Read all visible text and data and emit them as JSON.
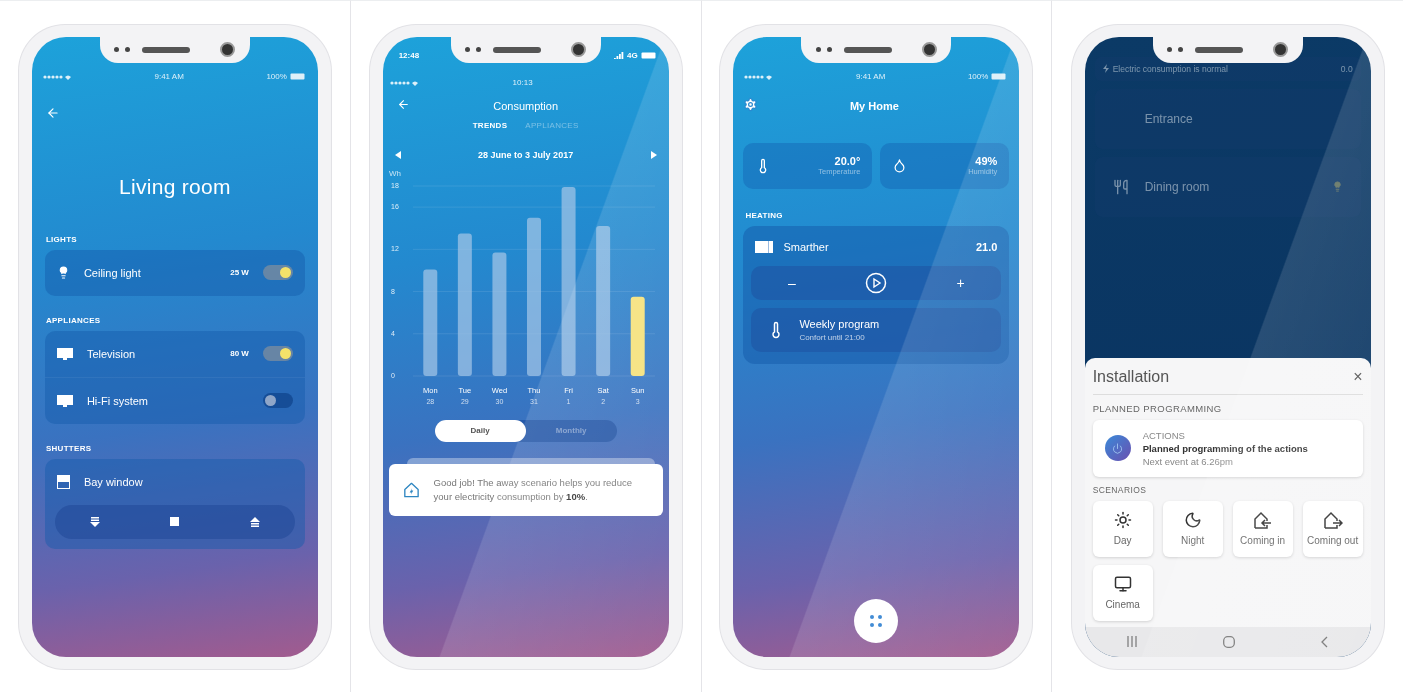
{
  "living_room": {
    "status": {
      "time": "9:41 AM",
      "battery": "100%"
    },
    "title": "Living room",
    "sections": [
      {
        "heading": "LIGHTS",
        "items": [
          {
            "kind": "light",
            "name": "Ceiling light",
            "power": "25 W",
            "on": true
          }
        ]
      },
      {
        "heading": "APPLIANCES",
        "items": [
          {
            "kind": "appliance",
            "name": "Television",
            "power": "80 W",
            "on": true
          },
          {
            "kind": "appliance",
            "name": "Hi-Fi system",
            "on": false
          }
        ]
      },
      {
        "heading": "SHUTTERS",
        "items": [
          {
            "kind": "shutter",
            "name": "Bay window"
          }
        ]
      }
    ]
  },
  "consumption": {
    "status": {
      "time": "12:48",
      "network": "4G"
    },
    "inner_status": {
      "time": "10:13"
    },
    "title": "Consumption",
    "tabs": [
      {
        "label": "TRENDS",
        "selected": true
      },
      {
        "label": "APPLIANCES",
        "selected": false
      }
    ],
    "period": "28 June to 3 July 2017",
    "chart_data": {
      "type": "bar",
      "ylabel": "Wh",
      "categories": [
        "Mon",
        "Tue",
        "Wed",
        "Thu",
        "Fri",
        "Sat",
        "Sun"
      ],
      "stacked": true,
      "grid": true,
      "ylim": [
        0,
        18
      ],
      "yticks": [
        0,
        4,
        8,
        12,
        16,
        18
      ],
      "series": [
        {
          "color": "#9fc3e6",
          "values": [
            10.1,
            13.5,
            11.7,
            15.0,
            17.9,
            14.2,
            null
          ]
        },
        {
          "color": "#f5e17a",
          "values": [
            null,
            null,
            null,
            null,
            null,
            null,
            7.5
          ]
        }
      ]
    },
    "dates": [
      "28",
      "29",
      "30",
      "31",
      "1",
      "2",
      "3"
    ],
    "periods": [
      {
        "label": "Daily",
        "selected": true
      },
      {
        "label": "Monthly",
        "selected": false
      }
    ],
    "tip": "Good job! The away scenario helps you reduce your electricity consumption by **10%**."
  },
  "my_home": {
    "status": {
      "time": "9:41 AM",
      "battery": "100%"
    },
    "title": "My Home",
    "readings": [
      {
        "kind": "temperature",
        "value": "20.0°",
        "label": "Temperature"
      },
      {
        "kind": "humidity",
        "value": "49%",
        "label": "Humidity"
      }
    ],
    "heating": {
      "heading": "HEATING",
      "device": "Smarther",
      "setpoint": "21.0",
      "decrease": "–",
      "increase": "+",
      "program": {
        "title": "Weekly program",
        "detail": "Confort until 21:00"
      }
    }
  },
  "installation": {
    "background": {
      "alert": "Electric consumption is normal",
      "reading": "0.0",
      "rooms": [
        {
          "kind": "entrance",
          "name": "Entrance"
        },
        {
          "kind": "dining",
          "name": "Dining room"
        }
      ]
    },
    "sheet": {
      "title": "Installation",
      "close": "×",
      "planned_heading": "PLANNED PROGRAMMING",
      "action": {
        "category": "ACTIONS",
        "title": "Planned programming of the actions",
        "detail": "Next event at 6.26pm"
      },
      "scenarios_heading": "SCENARIOS",
      "scenarios": [
        {
          "kind": "day",
          "label": "Day"
        },
        {
          "kind": "night",
          "label": "Night"
        },
        {
          "kind": "coming_in",
          "label": "Coming in"
        },
        {
          "kind": "coming_out",
          "label": "Coming out"
        },
        {
          "kind": "cinema",
          "label": "Cinema"
        }
      ]
    }
  }
}
